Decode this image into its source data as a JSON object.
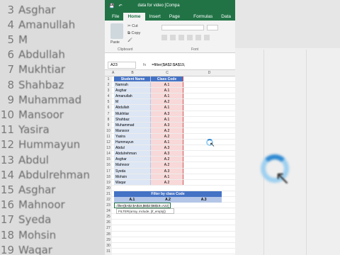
{
  "background_names": [
    {
      "num": "3",
      "name": "Asghar"
    },
    {
      "num": "4",
      "name": "Amanullah"
    },
    {
      "num": "5",
      "name": "M"
    },
    {
      "num": "6",
      "name": "Abdullah"
    },
    {
      "num": "7",
      "name": "Mukhtiar"
    },
    {
      "num": "8",
      "name": "Shahbaz"
    },
    {
      "num": "9",
      "name": "Muhammad"
    },
    {
      "num": "10",
      "name": "Mansoor"
    },
    {
      "num": "11",
      "name": "Yasira"
    },
    {
      "num": "12",
      "name": "Hummayun"
    },
    {
      "num": "13",
      "name": "Abdul"
    },
    {
      "num": "14",
      "name": "Abdulrehman"
    },
    {
      "num": "15",
      "name": "Asghar"
    },
    {
      "num": "16",
      "name": "Mahnoor"
    },
    {
      "num": "17",
      "name": "Syeda"
    },
    {
      "num": "18",
      "name": "Mohsin"
    },
    {
      "num": "19",
      "name": "Waqar"
    }
  ],
  "excel": {
    "doc_title": "data for video  [Compa",
    "tabs": [
      "File",
      "Home",
      "Insert",
      "Page Layout",
      "Formulas",
      "Data"
    ],
    "active_tab": "Home",
    "ribbon": {
      "paste": "Paste",
      "cut": "Cut",
      "copy": "Copy",
      "clipboard": "Clipboard",
      "font_group": "Font"
    },
    "name_box": "A23",
    "fx": "fx",
    "formula": "=filter($A$2:$A$19,",
    "col_headers": [
      "A",
      "B",
      "C",
      "D"
    ],
    "table_header": {
      "name": "Student Name",
      "code": "Class Code"
    },
    "rows": [
      {
        "name": "Namrah",
        "code": "A.1"
      },
      {
        "name": "Asghar",
        "code": "A.1"
      },
      {
        "name": "Amanullah",
        "code": "A.1"
      },
      {
        "name": "M",
        "code": "A.2"
      },
      {
        "name": "Abdullah",
        "code": "A.1"
      },
      {
        "name": "Mukhtiar",
        "code": "A.3"
      },
      {
        "name": "Shahbaz",
        "code": "A.1"
      },
      {
        "name": "Muhammad",
        "code": "A.3"
      },
      {
        "name": "Mansoor",
        "code": "A.2"
      },
      {
        "name": "Yasira",
        "code": "A.2"
      },
      {
        "name": "Hummayun",
        "code": "A.1"
      },
      {
        "name": "Abdul",
        "code": "A.3"
      },
      {
        "name": "Abdulrehman",
        "code": "A.3"
      },
      {
        "name": "Asghar",
        "code": "A.2"
      },
      {
        "name": "Mahnoor",
        "code": "A.2"
      },
      {
        "name": "Syeda",
        "code": "A.3"
      },
      {
        "name": "Mohsin",
        "code": "A.1"
      },
      {
        "name": "Waqar",
        "code": "A.2"
      }
    ],
    "filter_title": "Filter by class Code",
    "filter_cols": [
      "A.1",
      "A.2",
      "A.3"
    ],
    "filter_input": "=filter($A$2:$A$19,$B$2:$B$19=A22)",
    "tooltip": "FILTER(array, include, [if_empty])"
  }
}
